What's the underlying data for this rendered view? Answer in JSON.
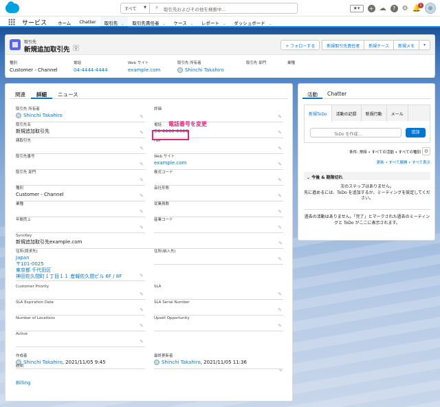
{
  "search": {
    "scope": "すべて",
    "placeholder": "取引先およびその他を検索中..."
  },
  "notification_count": "1",
  "nav": {
    "app_name": "サービス",
    "items": [
      {
        "label": "ホーム",
        "dropdown": false
      },
      {
        "label": "Chatter",
        "dropdown": false
      },
      {
        "label": "取引先",
        "dropdown": true,
        "active": true
      },
      {
        "label": "取引先責任者",
        "dropdown": true
      },
      {
        "label": "ケース",
        "dropdown": true
      },
      {
        "label": "レポート",
        "dropdown": true
      },
      {
        "label": "ダッシュボード",
        "dropdown": true
      }
    ]
  },
  "header": {
    "object_type": "取引先",
    "title": "新規追加取引先",
    "buttons": [
      "+ フォローする",
      "新規取引先責任者",
      "新規ケース",
      "新規メモ"
    ],
    "fields": [
      {
        "label": "種別",
        "value": "Customer - Channel",
        "link": false
      },
      {
        "label": "電話",
        "value": "04-4444-4444",
        "link": true
      },
      {
        "label": "Web サイト",
        "value": "example.com",
        "link": true
      },
      {
        "label": "取引先 所有者",
        "value": "Shinchi Takahiro",
        "link": true,
        "user": true
      },
      {
        "label": "取引先 部門",
        "value": "",
        "link": false
      },
      {
        "label": "業種",
        "value": "",
        "link": false
      }
    ]
  },
  "detail": {
    "tabs": [
      "関連",
      "詳細",
      "ニュース"
    ],
    "active_tab": "詳細",
    "annotation": "電話番号を変更",
    "left": [
      {
        "label": "取引先 所有者",
        "value": "Shinchi Takahiro",
        "link": true,
        "user": true
      },
      {
        "label": "取引先名",
        "value": "新規追加取引先"
      },
      {
        "label": "親取引先",
        "value": ""
      },
      {
        "label": "取引先番号",
        "value": ""
      },
      {
        "label": "取引先 部門",
        "value": ""
      },
      {
        "label": "種別",
        "value": "Customer - Channel"
      },
      {
        "label": "業種",
        "value": ""
      },
      {
        "label": "年間売上",
        "value": ""
      },
      {
        "label": "SyncKey",
        "value": "新規追加取引先example.com"
      },
      {
        "label": "住所(請求先)",
        "value": "Japan\n〒101-0025\n東京都 千代田区\n神田佐久間町１丁目１１ 産報佐久間ビル 6F / 8F",
        "link": true
      },
      {
        "label": "Customer Priority",
        "value": ""
      },
      {
        "label": "SLA Expiration Date",
        "value": ""
      },
      {
        "label": "Number of Locations",
        "value": ""
      },
      {
        "label": "Active",
        "value": ""
      },
      {
        "label": "作成者",
        "value": "Shinchi Takahiro",
        "suffix": ", 2021/11/05 9:45",
        "link": true,
        "user": true
      },
      {
        "label": "説明",
        "value": ""
      },
      {
        "label": "",
        "value": "Billing",
        "link": true
      }
    ],
    "right": [
      {
        "label": "評価",
        "value": ""
      },
      {
        "label": "電話",
        "value": "04-4444-4444",
        "link": true
      },
      {
        "label": "Fax",
        "value": ""
      },
      {
        "label": "Web サイト",
        "value": "example.com",
        "link": true
      },
      {
        "label": "株式コード",
        "value": ""
      },
      {
        "label": "会社形態",
        "value": ""
      },
      {
        "label": "従業員数",
        "value": ""
      },
      {
        "label": "産業コード",
        "value": ""
      },
      {
        "label": "住所(納入先)",
        "value": ""
      },
      {
        "label": "SLA",
        "value": ""
      },
      {
        "label": "SLA Serial Number",
        "value": ""
      },
      {
        "label": "Upsell Opportunity",
        "value": ""
      },
      {
        "label": "最終更新者",
        "value": "Shinchi Takahiro",
        "suffix": ", 2021/11/05 11:36",
        "link": true,
        "user": true
      }
    ]
  },
  "activity": {
    "tabs": [
      "活動",
      "Chatter"
    ],
    "subtabs": [
      "新規ToDo",
      "活動の記録",
      "新規行動",
      "メール"
    ],
    "todo_placeholder": "ToDo を作成...",
    "add_button": "追加",
    "filter": "条件: 常時 • すべての活動 • すべての種別",
    "links": "更新 • すべて展開 • すべて表示",
    "upcoming_title": "今後 & 期限切れ",
    "upcoming_msg": "次のステップはありません。\n先に進めるには、ToDo を追加するか、ミーティングを設定してください。",
    "past_msg": "過去の活動はありません。「完了」とマークされた過去のミーティングと ToDo がここに表示されます。"
  }
}
